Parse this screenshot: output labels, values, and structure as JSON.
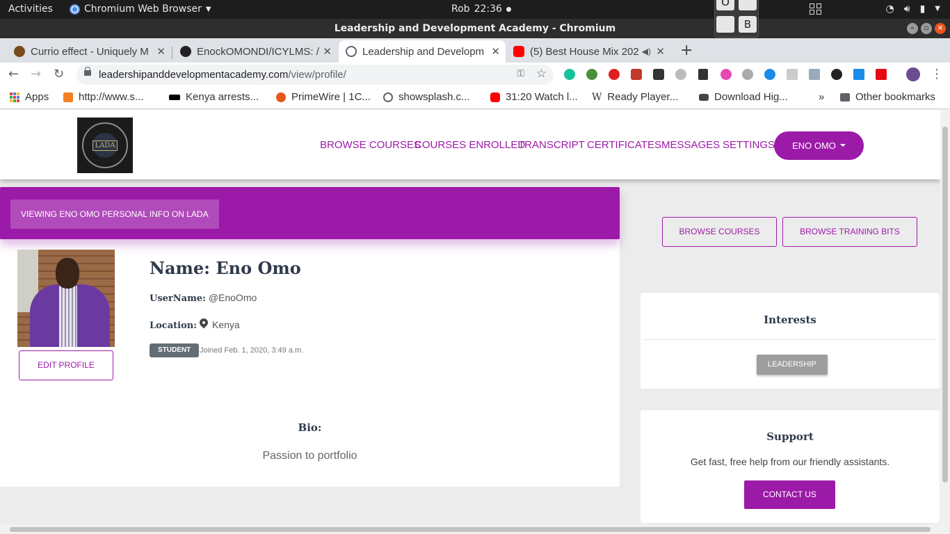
{
  "system": {
    "activities": "Activities",
    "app_name": "Chromium Web Browser",
    "user": "Rob",
    "time": "22:36",
    "keys": [
      "O",
      "B"
    ]
  },
  "window": {
    "title": "Leadership and Development Academy - Chromium"
  },
  "tabs": [
    {
      "title": "Currio effect - Uniquely M",
      "favicon": "curriosity-icon",
      "color": "#7a4a1a"
    },
    {
      "title": "EnockOMONDI/ICYLMS: /",
      "favicon": "github-icon",
      "color": "#222222"
    },
    {
      "title": "Leadership and Developm",
      "favicon": "globe-icon",
      "color": "#5f6368"
    },
    {
      "title": "(5) Best House Mix 202",
      "favicon": "youtube-icon",
      "color": "#ff0000"
    }
  ],
  "address": {
    "domain": "leadershipanddevelopmentacademy.com",
    "path": "/view/profile/"
  },
  "bookmarks": [
    {
      "label": "Apps",
      "icon": "apps-grid-icon"
    },
    {
      "label": "http://www.s...",
      "icon": "stackoverflow-icon",
      "color": "#f48024"
    },
    {
      "label": "Kenya arrests...",
      "icon": "bbc-icon",
      "color": "#000000"
    },
    {
      "label": "PrimeWire | 1C...",
      "icon": "primewire-icon",
      "color": "#e8561c"
    },
    {
      "label": "showsplash.c...",
      "icon": "globe-icon",
      "color": "#5f6368"
    },
    {
      "label": "31:20 Watch l...",
      "icon": "youtube-icon",
      "color": "#ff0000"
    },
    {
      "label": "Ready Player...",
      "icon": "wikipedia-icon",
      "color": "#333333"
    },
    {
      "label": "Download Hig...",
      "icon": "car-icon",
      "color": "#444444"
    }
  ],
  "bookmarks_more": "»",
  "other_bookmarks": "Other bookmarks",
  "site": {
    "logo_text": "LADA",
    "nav": [
      "BROWSE COURSES",
      "COURSES ENROLLED",
      "TRANSCRIPT",
      "CERTIFICATES",
      "MESSAGES",
      "SETTINGS"
    ],
    "user_menu": "ENO OMO",
    "accent": "#9c1aa8"
  },
  "profile": {
    "header": "VIEWING ENO OMO PERSONAL INFO ON LADA",
    "name": "Name: Eno Omo",
    "username_label": "UserName:",
    "username": "@EnoOmo",
    "location_label": "Location:",
    "location": "Kenya",
    "role": "STUDENT",
    "joined": "Joined Feb. 1, 2020, 3:49 a.m.",
    "edit": "EDIT PROFILE",
    "bio_label": "Bio:",
    "bio": "Passion to portfolio"
  },
  "sidebar": {
    "browse_courses": "BROWSE COURSES",
    "browse_bits": "BROWSE TRAINING BITS",
    "interests_title": "Interests",
    "interests": [
      "LEADERSHIP"
    ],
    "support_title": "Support",
    "support_text": "Get fast, free help from our friendly assistants.",
    "contact": "CONTACT US"
  }
}
